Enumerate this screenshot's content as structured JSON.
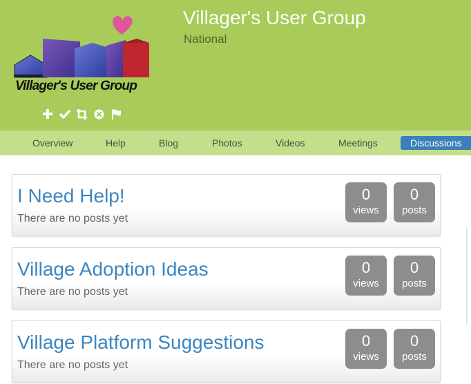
{
  "group": {
    "name": "Villager's User Group",
    "subtitle": "National",
    "logo_text": "Villager's User Group"
  },
  "actions": [
    {
      "icon": "plus-icon"
    },
    {
      "icon": "check-icon"
    },
    {
      "icon": "crop-icon"
    },
    {
      "icon": "close-circle-icon"
    },
    {
      "icon": "flag-icon"
    }
  ],
  "nav": {
    "items": [
      "Overview",
      "Help",
      "Blog",
      "Photos",
      "Videos",
      "Meetings",
      "Discussions"
    ],
    "active": "Discussions"
  },
  "discussions": [
    {
      "title": "I Need Help!",
      "desc": "There are no posts yet",
      "views": "0",
      "views_label": "views",
      "posts": "0",
      "posts_label": "posts"
    },
    {
      "title": "Village Adoption Ideas",
      "desc": "There are no posts yet",
      "views": "0",
      "views_label": "views",
      "posts": "0",
      "posts_label": "posts"
    },
    {
      "title": "Village Platform Suggestions",
      "desc": "There are no posts yet",
      "views": "0",
      "views_label": "views",
      "posts": "0",
      "posts_label": "posts"
    }
  ],
  "colors": {
    "header_bg": "#a8cb5a",
    "nav_bg": "#c3df8c",
    "active_tab": "#3b80ba",
    "link": "#3b86c1",
    "stat_bg": "#8d8d8d"
  }
}
